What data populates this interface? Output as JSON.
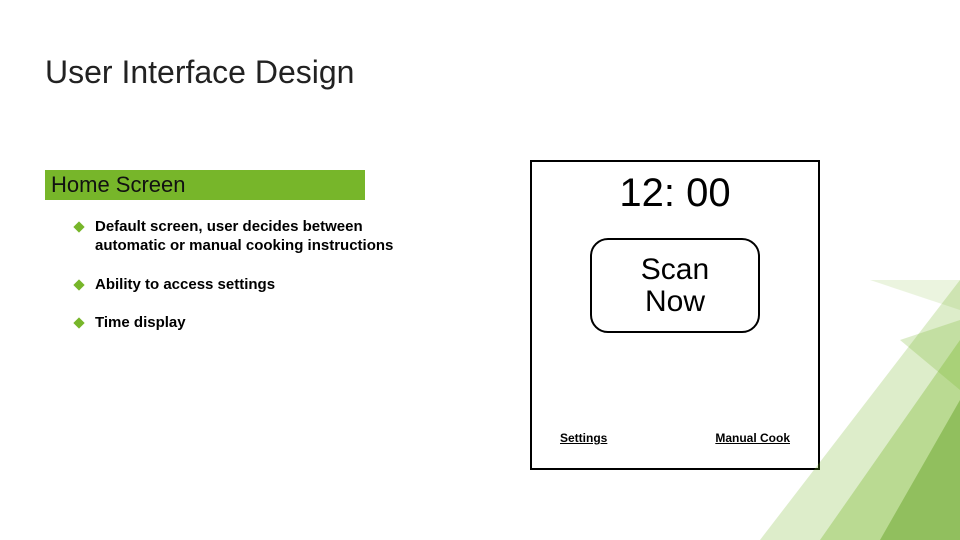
{
  "title": "User Interface Design",
  "left": {
    "heading": "Home Screen",
    "bullets": [
      "Default screen, user decides between automatic or manual cooking instructions",
      "Ability to access settings",
      "Time display"
    ]
  },
  "mock": {
    "time": "12: 00",
    "scan_label": "Scan\nNow",
    "settings_label": "Settings",
    "manual_label": "Manual Cook"
  }
}
